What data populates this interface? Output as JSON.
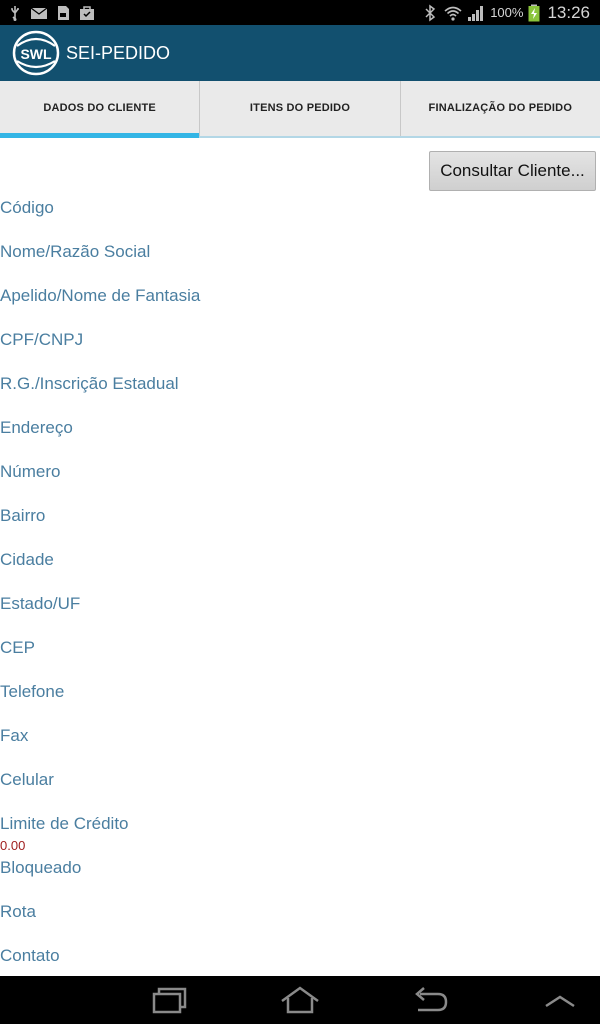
{
  "status_bar": {
    "battery": "100%",
    "time": "13:26"
  },
  "app": {
    "logo_text": "SWL",
    "title": "SEI-PEDIDO"
  },
  "tabs": [
    {
      "label": "DADOS DO CLIENTE",
      "active": true
    },
    {
      "label": "ITENS DO PEDIDO",
      "active": false
    },
    {
      "label": "FINALIZAÇÃO DO PEDIDO",
      "active": false
    }
  ],
  "consult_button": "Consultar Cliente...",
  "fields": [
    {
      "label": "Código"
    },
    {
      "label": "Nome/Razão Social"
    },
    {
      "label": "Apelido/Nome de Fantasia"
    },
    {
      "label": "CPF/CNPJ"
    },
    {
      "label": "R.G./Inscrição Estadual"
    },
    {
      "label": "Endereço"
    },
    {
      "label": "Número"
    },
    {
      "label": "Bairro"
    },
    {
      "label": "Cidade"
    },
    {
      "label": "Estado/UF"
    },
    {
      "label": "CEP"
    },
    {
      "label": "Telefone"
    },
    {
      "label": "Fax"
    },
    {
      "label": "Celular"
    },
    {
      "label": "Limite de Crédito",
      "value": "0.00"
    },
    {
      "label": "Bloqueado"
    },
    {
      "label": "Rota"
    },
    {
      "label": "Contato"
    }
  ],
  "colors": {
    "action_bar": "#12506f",
    "tab_indicator": "#33b5e5",
    "label": "#4a7ea0",
    "value": "#a02020"
  }
}
